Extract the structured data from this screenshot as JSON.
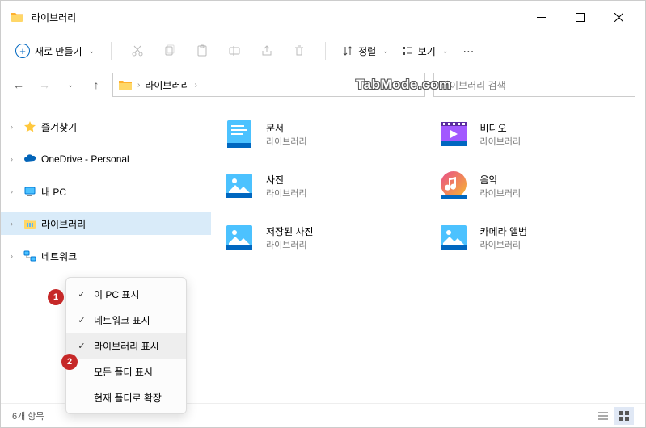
{
  "window": {
    "title": "라이브러리"
  },
  "toolbar": {
    "new_label": "새로 만들기",
    "sort_label": "정렬",
    "view_label": "보기"
  },
  "breadcrumb": {
    "root": "라이브러리"
  },
  "search": {
    "placeholder": "라이브러리 검색"
  },
  "watermark": "TabMode.com",
  "sidebar": {
    "items": [
      {
        "label": "즐겨찾기",
        "icon": "star"
      },
      {
        "label": "OneDrive - Personal",
        "icon": "onedrive"
      },
      {
        "label": "내 PC",
        "icon": "pc"
      },
      {
        "label": "라이브러리",
        "icon": "library",
        "selected": true
      },
      {
        "label": "네트워크",
        "icon": "network"
      }
    ]
  },
  "libraries": [
    {
      "name": "문서",
      "sub": "라이브러리",
      "icon": "doc"
    },
    {
      "name": "비디오",
      "sub": "라이브러리",
      "icon": "video"
    },
    {
      "name": "사진",
      "sub": "라이브러리",
      "icon": "photo"
    },
    {
      "name": "음악",
      "sub": "라이브러리",
      "icon": "music"
    },
    {
      "name": "저장된 사진",
      "sub": "라이브러리",
      "icon": "photo"
    },
    {
      "name": "카메라 앨범",
      "sub": "라이브러리",
      "icon": "photo"
    }
  ],
  "context_menu": {
    "items": [
      {
        "label": "이 PC 표시",
        "checked": true
      },
      {
        "label": "네트워크 표시",
        "checked": true
      },
      {
        "label": "라이브러리 표시",
        "checked": true,
        "hover": true
      },
      {
        "label": "모든 폴더 표시",
        "checked": false
      },
      {
        "label": "현재 폴더로 확장",
        "checked": false
      }
    ]
  },
  "badges": {
    "b1": "1",
    "b2": "2"
  },
  "status": {
    "count": "6개 항목"
  }
}
